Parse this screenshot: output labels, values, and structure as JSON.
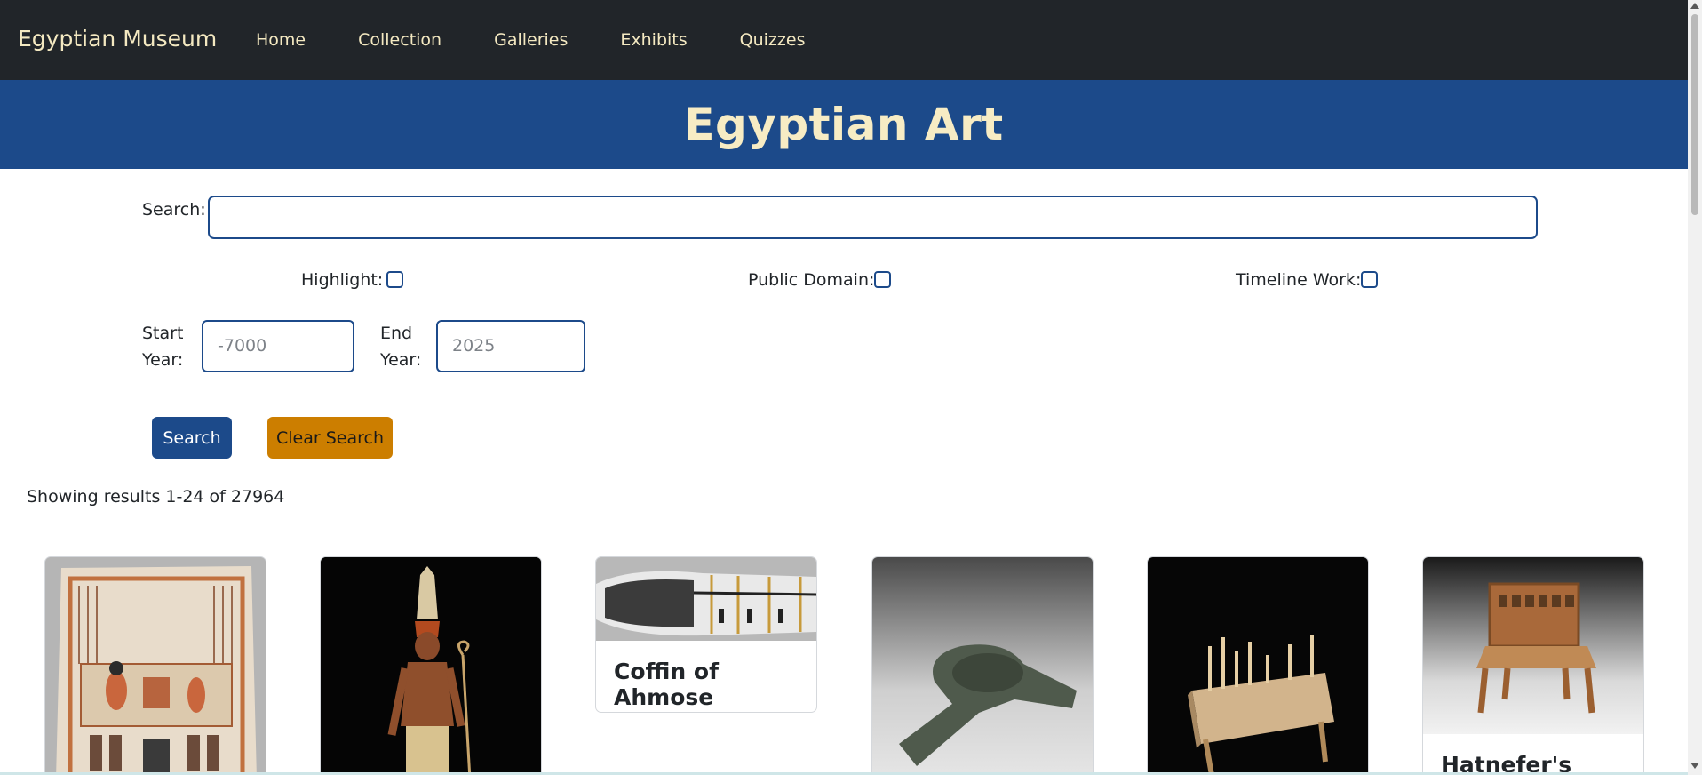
{
  "navbar": {
    "brand": "Egyptian Museum",
    "links": [
      "Home",
      "Collection",
      "Galleries",
      "Exhibits",
      "Quizzes"
    ]
  },
  "hero": {
    "title": "Egyptian Art"
  },
  "form": {
    "search_label": "Search:",
    "search_value": "",
    "highlight_label": "Highlight:",
    "public_domain_label": "Public Domain:",
    "timeline_label": "Timeline Work:",
    "start_label_1": "Start",
    "start_label_2": "Year:",
    "start_placeholder": "-7000",
    "end_label_1": "End",
    "end_label_2": "Year:",
    "end_placeholder": "2025",
    "search_button": "Search",
    "clear_button": "Clear Search"
  },
  "results": {
    "text": "Showing results 1-24 of 27964"
  },
  "cards": [
    {
      "title": "",
      "image": "stela-relief"
    },
    {
      "title": "",
      "image": "standing-king-statue"
    },
    {
      "title": "Coffin of Ahmose",
      "image": "coffin"
    },
    {
      "title": "",
      "image": "ankh-shaped-vessel"
    },
    {
      "title": "",
      "image": "game-board"
    },
    {
      "title": "Hatnefer's Chair",
      "image": "wooden-chair"
    }
  ],
  "colors": {
    "navbar": "#212529",
    "hero": "#1c4a8a",
    "accent_text": "#f4e9c1",
    "search_button": "#1c4a8a",
    "clear_button": "#cc7e00"
  }
}
